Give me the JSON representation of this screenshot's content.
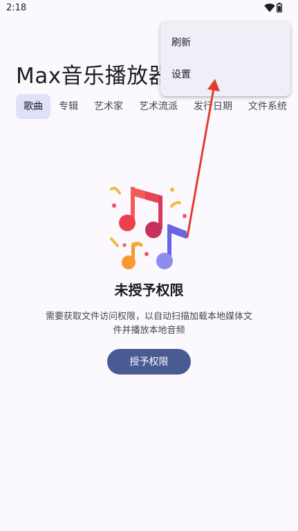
{
  "status_bar": {
    "time": "2:18",
    "icons": [
      "wifi-icon",
      "battery-icon"
    ]
  },
  "app": {
    "title": "Max音乐播放器"
  },
  "tabs": [
    {
      "label": "歌曲",
      "active": true
    },
    {
      "label": "专辑",
      "active": false
    },
    {
      "label": "艺术家",
      "active": false
    },
    {
      "label": "艺术流派",
      "active": false
    },
    {
      "label": "发行日期",
      "active": false
    },
    {
      "label": "文件系统",
      "active": false
    }
  ],
  "empty_state": {
    "illustration": "music-notes-icon",
    "title": "未授予权限",
    "description": "需要获取文件访问权限，以自动扫描加载本地媒体文件并播放本地音频",
    "button_label": "授予权限"
  },
  "menu": {
    "items": [
      {
        "label": "刷新"
      },
      {
        "label": "设置"
      }
    ]
  },
  "colors": {
    "background": "#fbf8fe",
    "tab_active": "#dfe1f9",
    "primary_button": "#4a5a92",
    "menu_background": "#efeff8",
    "annotation_arrow": "#e53b2c"
  }
}
